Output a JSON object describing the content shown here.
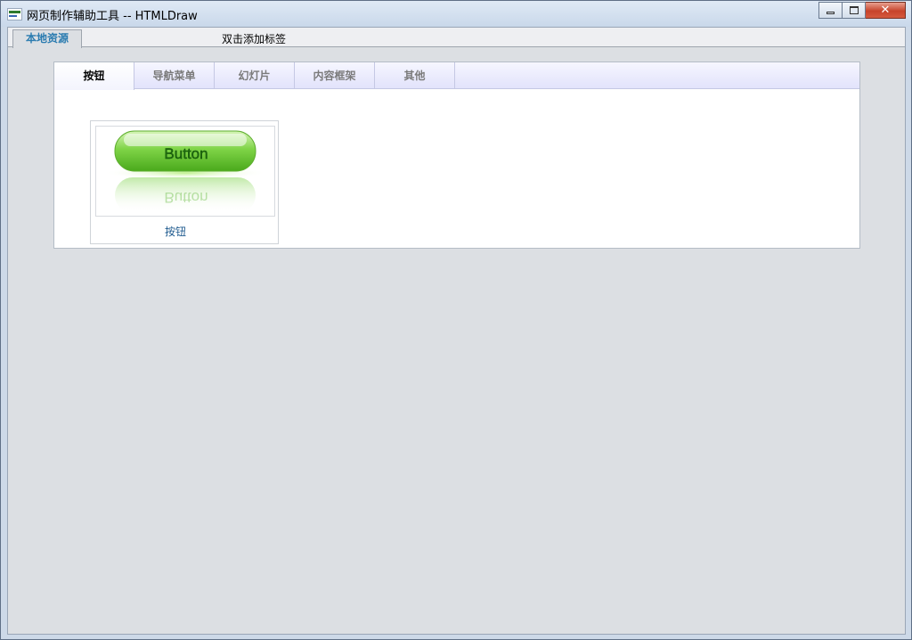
{
  "window": {
    "title": "网页制作辅助工具 -- HTMLDraw",
    "controls": {
      "minimize": "minimize",
      "maximize": "restore",
      "close": "✕"
    }
  },
  "top_tabs": {
    "active_label": "本地资源",
    "add_hint": "双击添加标签"
  },
  "category_tabs": [
    {
      "label": "按钮",
      "active": true
    },
    {
      "label": "导航菜单",
      "active": false
    },
    {
      "label": "幻灯片",
      "active": false
    },
    {
      "label": "内容框架",
      "active": false
    },
    {
      "label": "其他",
      "active": false
    }
  ],
  "resources": [
    {
      "label": "按钮",
      "preview_text": "Button",
      "preview_icon": "green-glossy-button"
    }
  ],
  "colors": {
    "active_top_tab": "#2a7bb0",
    "resource_label": "#1e5a8e",
    "preview_green": "#5ec22a"
  }
}
